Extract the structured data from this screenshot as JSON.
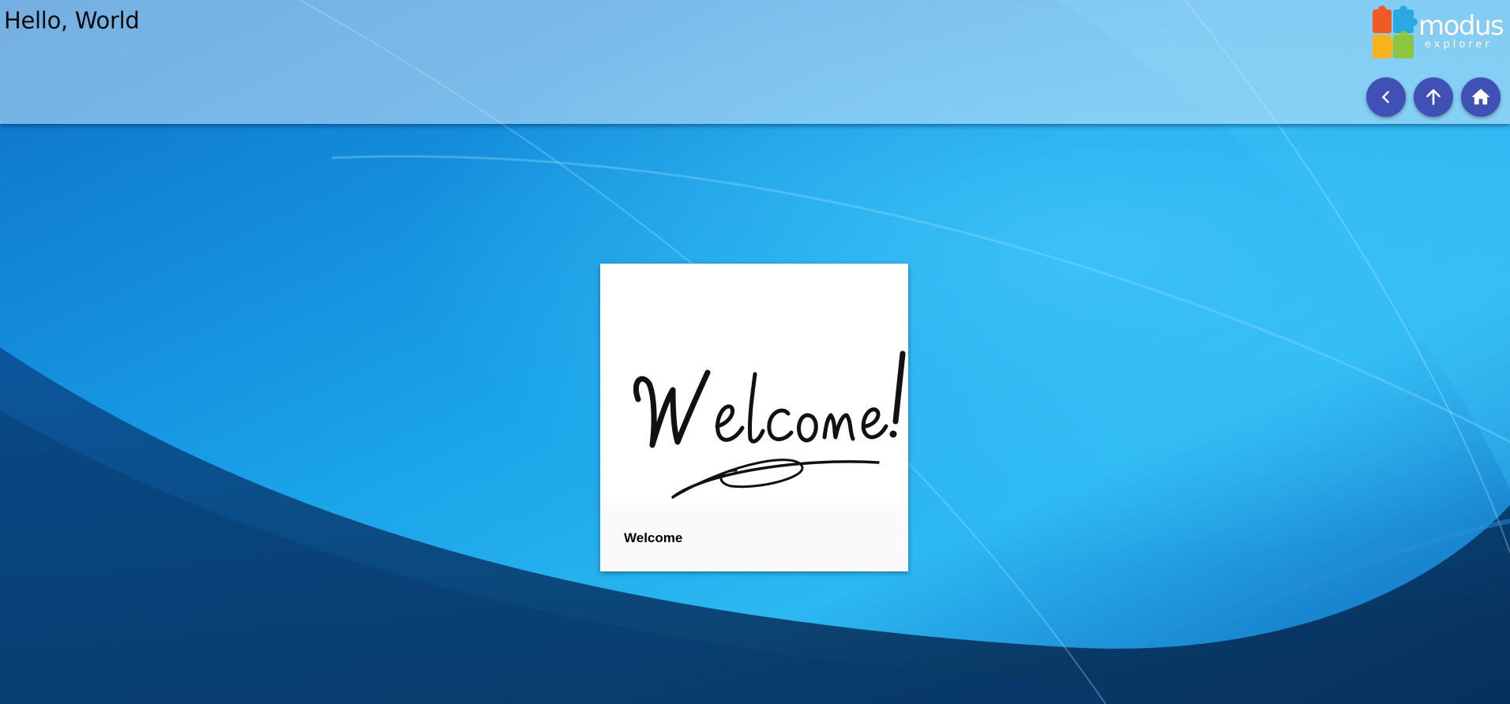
{
  "header": {
    "greeting": "Hello, World",
    "logo": {
      "name": "modus-explorer-logo",
      "word": "modus",
      "subword": "explorer",
      "piece_colors": [
        "#f15a24",
        "#29a9e1",
        "#f7b31b",
        "#8cc63f"
      ]
    },
    "nav_buttons": [
      {
        "name": "back-button",
        "icon": "chevron-left-icon"
      },
      {
        "name": "up-button",
        "icon": "arrow-up-icon"
      },
      {
        "name": "home-button",
        "icon": "home-icon"
      }
    ],
    "accent_color": "#3f51b5"
  },
  "main": {
    "card": {
      "title": "Welcome",
      "image_text": "Welcome!"
    }
  }
}
